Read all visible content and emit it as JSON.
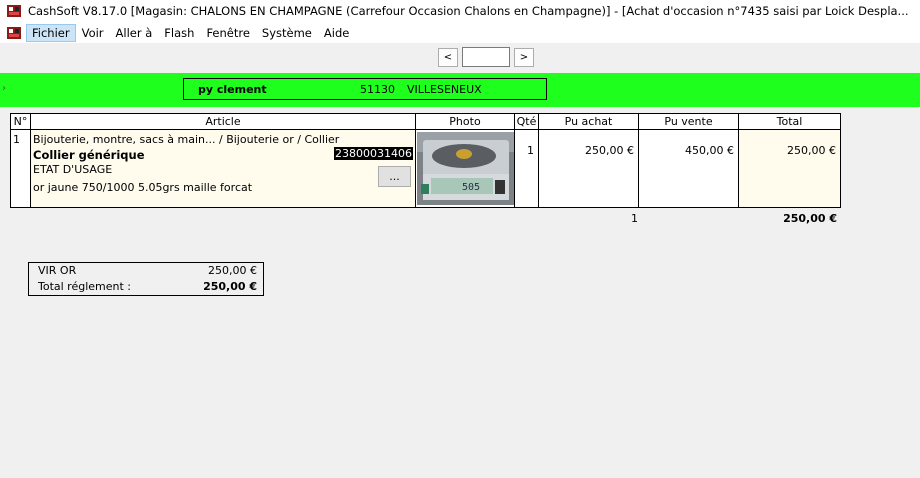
{
  "window": {
    "title": "CashSoft V8.17.0 [Magasin: CHALONS EN CHAMPAGNE (Carrefour Occasion Chalons en Champagne)] - [Achat d'occasion n°7435 saisi par Loick Despla..."
  },
  "menu": {
    "items": [
      "Fichier",
      "Voir",
      "Aller à",
      "Flash",
      "Fenêtre",
      "Système",
      "Aide"
    ]
  },
  "nav": {
    "prev": "<",
    "next": ">",
    "page_value": ""
  },
  "client": {
    "name": "py clement",
    "zip": "51130",
    "city": "VILLESENEUX"
  },
  "table": {
    "headers": [
      "N°",
      "Article",
      "Photo",
      "Qté",
      "Pu achat",
      "Pu vente",
      "Total"
    ],
    "rows": [
      {
        "num": "1",
        "category": "Bijouterie, montre, sacs à main... / Bijouterie or / Collier",
        "name": "Collier générique",
        "code": "23800031406",
        "state": "ETAT D'USAGE",
        "description": "or jaune 750/1000 5.05grs maille forcat",
        "button": "...",
        "qty": "1",
        "pu_achat": "250,00 €",
        "pu_vente": "450,00 €",
        "total": "250,00 €",
        "photo_display": "505"
      }
    ]
  },
  "totals": {
    "qty": "1",
    "total": "250,00 €"
  },
  "payment": {
    "rows": [
      {
        "label": "VIR OR",
        "value": "250,00 €"
      },
      {
        "label": "Total réglement :",
        "value": "250,00 €"
      }
    ]
  },
  "colors": {
    "band": "#1eff1e",
    "row_highlight": "#fffcee"
  }
}
